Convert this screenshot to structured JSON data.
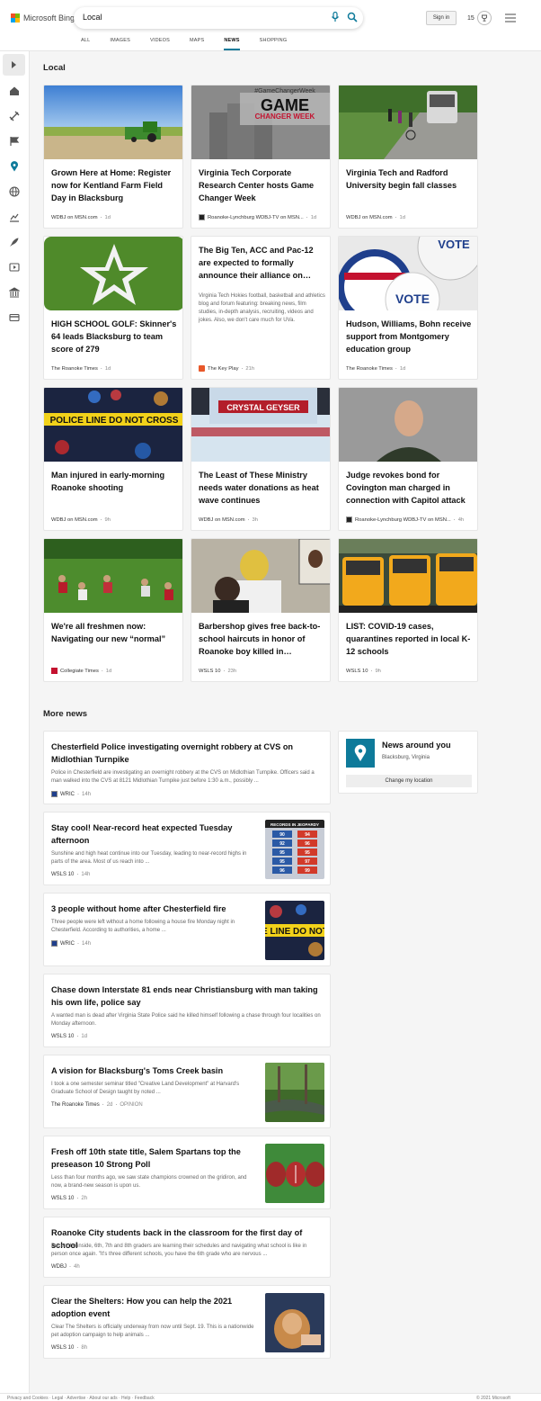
{
  "brand": {
    "name": "Microsoft Bing"
  },
  "search": {
    "value": "Local"
  },
  "header": {
    "signin": "Sign in",
    "points": "15"
  },
  "tabs": [
    {
      "label": "ALL",
      "active": false
    },
    {
      "label": "IMAGES",
      "active": false
    },
    {
      "label": "VIDEOS",
      "active": false
    },
    {
      "label": "MAPS",
      "active": false
    },
    {
      "label": "NEWS",
      "active": true
    },
    {
      "label": "SHOPPING",
      "active": false
    }
  ],
  "sidebar": {
    "icons": [
      "expand-icon",
      "home-icon",
      "satellite-icon",
      "flag-icon",
      "location-pin-icon",
      "globe-icon",
      "chart-icon",
      "rocket-icon",
      "video-icon",
      "bank-icon",
      "card-icon"
    ]
  },
  "local": {
    "title": "Local",
    "cards": [
      {
        "title": "Grown Here at Home: Register now for Kentland Farm Field Day in Blacksburg",
        "source": "WDBJ on MSN.com",
        "age": "1d"
      },
      {
        "title": "Virginia Tech Corporate Research Center hosts Game Changer Week",
        "source": "Roanoke-Lynchburg WDBJ-TV on MSN...",
        "age": "1d",
        "img_text": "#GameChangerWeek",
        "img_big": "GAME",
        "img_big2": "CHANGER WEEK"
      },
      {
        "title": "Virginia Tech and Radford University begin fall classes",
        "source": "WDBJ on MSN.com",
        "age": "1d"
      },
      {
        "title": "HIGH SCHOOL GOLF: Skinner's 64 leads Blacksburg to team score of 279",
        "source": "The Roanoke Times",
        "age": "1d"
      },
      {
        "title": "The Big Ten, ACC and Pac-12 are expected to formally announce their alliance on…",
        "desc": "Virginia Tech Hokies football, basketball and athletics blog and forum featuring: breaking news, film studies, in-depth analysis, recruiting, videos and jokes. Also, we don't care much for UVa.",
        "source": "The Key Play",
        "age": "21h"
      },
      {
        "title": "Hudson, Williams, Bohn receive support from Montgomery education group",
        "source": "The Roanoke Times",
        "age": "1d",
        "img_text": "VOTE"
      },
      {
        "title": "Man injured in early-morning Roanoke shooting",
        "source": "WDBJ on MSN.com",
        "age": "9h",
        "img_text": "POLICE LINE DO NOT CROSS"
      },
      {
        "title": "The Least of These Ministry needs water donations as heat wave continues",
        "source": "WDBJ on MSN.com",
        "age": "3h",
        "img_text": "CRYSTAL GEYSER"
      },
      {
        "title": "Judge revokes bond for Covington man charged in connection with Capitol attack",
        "source": "Roanoke-Lynchburg WDBJ-TV on MSN...",
        "age": "4h"
      },
      {
        "title": "We're all freshmen now: Navigating our new “normal”",
        "source": "Collegiate Times",
        "age": "1d"
      },
      {
        "title": "Barbershop gives free back-to-school haircuts in honor of Roanoke boy killed in…",
        "source": "WSLS 10",
        "age": "23h"
      },
      {
        "title": "LIST: COVID-19 cases, quarantines reported in local K-12 schools",
        "source": "WSLS 10",
        "age": "9h"
      }
    ]
  },
  "more_news": {
    "title": "More news",
    "items": [
      {
        "title": "Chesterfield Police investigating overnight robbery at CVS on Midlothian Turnpike",
        "snippet": "Police in Chesterfield are investigating an overnight robbery at the CVS on Midlothian Turnpike. Officers said a man walked into the CVS at 8121 Midlothian Turnpike just before 1:30 a.m., possibly ...",
        "source": "WRIC",
        "age": "14h"
      },
      {
        "title": "Stay cool! Near-record heat expected Tuesday afternoon",
        "snippet": "Sunshine and high heat continue into our Tuesday, leading to near-record highs in parts of the area. Most of us reach into ...",
        "source": "WSLS 10",
        "age": "14h",
        "thumb_title": "RECORDS IN JEOPARDY",
        "thumb_rows": [
          [
            "90",
            "94"
          ],
          [
            "92",
            "96"
          ],
          [
            "95",
            "95"
          ],
          [
            "95",
            "97"
          ],
          [
            "96",
            "99"
          ]
        ]
      },
      {
        "title": "3 people without home after Chesterfield fire",
        "snippet": "Three people were left without a home following a house fire Monday night in Chesterfield. According to authorities, a home ...",
        "source": "WRIC",
        "age": "14h",
        "thumb_text": "E LINE DO NOT"
      },
      {
        "title": "Chase down Interstate 81 ends near Christiansburg with man taking his own life, police say",
        "snippet": "A wanted man is dead after Virginia State Police said he killed himself following a chase through four localities on Monday afternoon.",
        "source": "WSLS 10",
        "age": "1d"
      },
      {
        "title": "A vision for Blacksburg's Toms Creek basin",
        "snippet": "I took a one semester seminar titled \"Creative Land Development\" at Harvard's Graduate School of Design taught by noted ...",
        "source": "The Roanoke Times",
        "age": "2d",
        "tag": "OPINION"
      },
      {
        "title": "Fresh off 10th state title, Salem Spartans top the preseason 10 Strong Poll",
        "snippet": "Less than four months ago, we saw state champions crowned on the gridiron, and now, a brand-new season is upon us.",
        "source": "WSLS 10",
        "age": "2h"
      },
      {
        "title": "Roanoke City students back in the classroom for the first day of school",
        "snippet": "But on the inside, 6th, 7th and 8th graders are learning their schedules and navigating what school is like in person once again. \"It's three different schools, you have the 6th grade who are nervous ...",
        "source": "WDBJ",
        "age": "4h"
      },
      {
        "title": "Clear the Shelters: How you can help the 2021 adoption event",
        "snippet": "Clear The Shelters is officially underway from now until Sept. 19. This is a nationwide pet adoption campaign to help animals ...",
        "source": "WSLS 10",
        "age": "8h"
      }
    ]
  },
  "around": {
    "title": "News around you",
    "location": "Blacksburg, Virginia",
    "button": "Change my location"
  },
  "footer": {
    "left": "Privacy and Cookies · Legal · Advertise · About our ads · Help · Feedback",
    "right": "© 2021 Microsoft"
  },
  "colors": {
    "accent": "#0e7a9a"
  }
}
